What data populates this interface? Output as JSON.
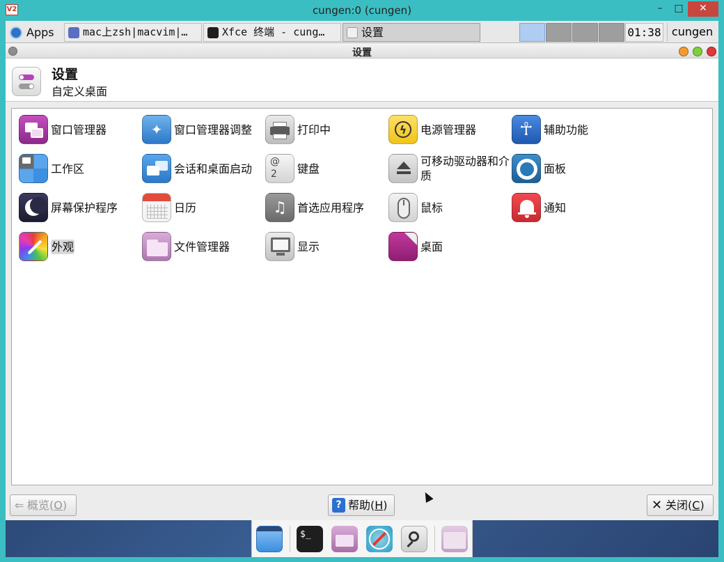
{
  "outer_window": {
    "logo_text": "V2",
    "title": "cungen:0 (cungen)",
    "minimize_label": "–",
    "maximize_label": "□",
    "close_label": "✕"
  },
  "panel": {
    "apps_label": "Apps",
    "tasks": [
      {
        "label": "mac上zsh|macvim|…",
        "icon": "app-window-icon"
      },
      {
        "label": "Xfce 终端 - cung…",
        "icon": "terminal-icon"
      },
      {
        "label": "设置",
        "icon": "settings-icon"
      }
    ],
    "clock": "01:38",
    "user": "cungen"
  },
  "settings": {
    "window_title": "设置",
    "header_title": "设置",
    "header_subtitle": "自定义桌面",
    "items": [
      {
        "label": "窗口管理器",
        "icon": "window-manager-icon",
        "color": "#b03aa8"
      },
      {
        "label": "窗口管理器调整",
        "icon": "window-tweaks-icon",
        "color": "#3f8ed8"
      },
      {
        "label": "打印中",
        "icon": "printer-icon",
        "color": "#d0d0d0"
      },
      {
        "label": "电源管理器",
        "icon": "power-icon",
        "color": "#f5d23a"
      },
      {
        "label": "辅助功能",
        "icon": "accessibility-icon",
        "color": "#2f6fc9"
      },
      {
        "label": "工作区",
        "icon": "workspace-icon",
        "color": "#3d8fe0"
      },
      {
        "label": "会话和桌面启动",
        "icon": "session-icon",
        "color": "#3d8fe0"
      },
      {
        "label": "键盘",
        "icon": "keyboard-icon",
        "color": "#e6e6e6",
        "key_top": "@",
        "key_bottom": "2"
      },
      {
        "label": "可移动驱动器和介质",
        "icon": "eject-icon",
        "color": "#d8d8d8"
      },
      {
        "label": "面板",
        "icon": "panel-icon",
        "color": "#2a7ab8"
      },
      {
        "label": "屏幕保护程序",
        "icon": "screensaver-icon",
        "color": "#2c2c48"
      },
      {
        "label": "日历",
        "icon": "calendar-icon",
        "color": "#f2f2f2"
      },
      {
        "label": "首选应用程序",
        "icon": "preferred-apps-icon",
        "color": "#8a8a8a"
      },
      {
        "label": "鼠标",
        "icon": "mouse-icon",
        "color": "#e8e8e8"
      },
      {
        "label": "通知",
        "icon": "notification-icon",
        "color": "#e2363d"
      },
      {
        "label": "外观",
        "icon": "appearance-icon",
        "color": "#7a3ab8",
        "highlighted": true
      },
      {
        "label": "文件管理器",
        "icon": "file-manager-icon",
        "color": "#c496c4"
      },
      {
        "label": "显示",
        "icon": "display-icon",
        "color": "#cfcfcf"
      },
      {
        "label": "桌面",
        "icon": "desktop-icon",
        "color": "#b0308c"
      }
    ],
    "buttons": {
      "overview": {
        "label": "概览",
        "mnemonic": "O"
      },
      "help": {
        "label": "帮助",
        "mnemonic": "H"
      },
      "close": {
        "label": "关闭",
        "mnemonic": "C"
      }
    }
  },
  "dock": {
    "items": [
      "show-desktop-icon",
      "terminal-icon",
      "file-manager-icon",
      "web-browser-icon",
      "app-finder-icon",
      "folder-icon"
    ]
  }
}
